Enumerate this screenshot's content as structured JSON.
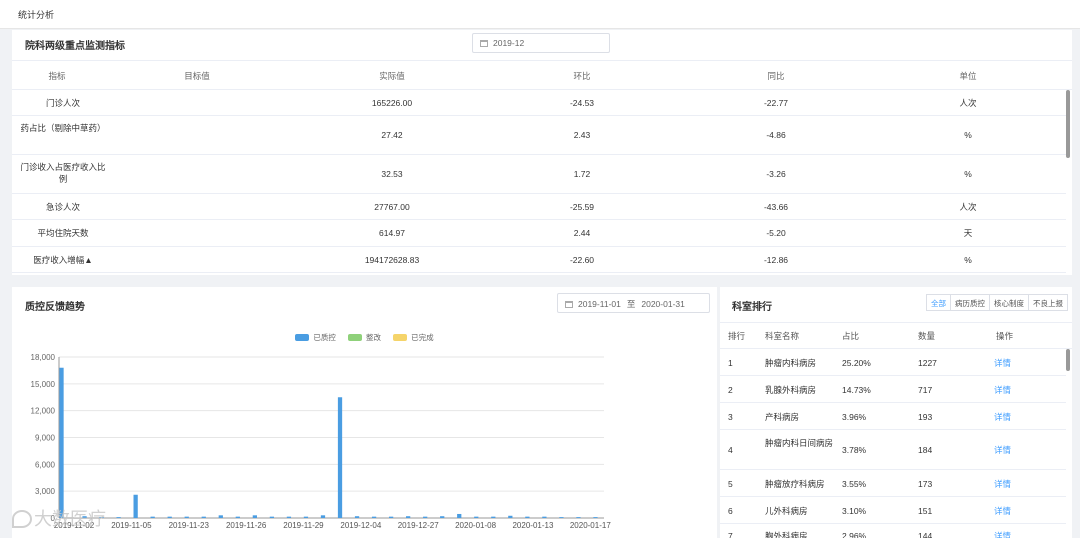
{
  "header": {
    "title": "统计分析"
  },
  "indicators": {
    "title": "院科两级重点监测指标",
    "date": "2019-12",
    "columns": [
      "指标",
      "目标值",
      "实际值",
      "环比",
      "同比",
      "单位"
    ],
    "rows": [
      {
        "name": "门诊人次",
        "target": "",
        "actual": "165226.00",
        "mom": "-24.53",
        "yoy": "-22.77",
        "unit": "人次"
      },
      {
        "name": "药占比（剔除中草药）",
        "target": "",
        "actual": "27.42",
        "mom": "2.43",
        "yoy": "-4.86",
        "unit": "%"
      },
      {
        "name": "门诊收入占医疗收入比例",
        "target": "",
        "actual": "32.53",
        "mom": "1.72",
        "yoy": "-3.26",
        "unit": "%"
      },
      {
        "name": "急诊人次",
        "target": "",
        "actual": "27767.00",
        "mom": "-25.59",
        "yoy": "-43.66",
        "unit": "人次"
      },
      {
        "name": "平均住院天数",
        "target": "",
        "actual": "614.97",
        "mom": "2.44",
        "yoy": "-5.20",
        "unit": "天"
      },
      {
        "name": "医疗收入增幅▲",
        "target": "",
        "actual": "194172628.83",
        "mom": "-22.60",
        "yoy": "-12.86",
        "unit": "%"
      }
    ]
  },
  "trend": {
    "title": "质控反馈趋势",
    "date_start": "2019-11-01",
    "date_sep": "至",
    "date_end": "2020-01-31",
    "watermark": "大数医疗"
  },
  "chart_data": {
    "type": "bar",
    "x_tick_labels": [
      "2019-11-02",
      "2019-11-05",
      "2019-11-23",
      "2019-11-26",
      "2019-11-29",
      "2019-12-04",
      "2019-12-27",
      "2020-01-08",
      "2020-01-13",
      "2020-01-17"
    ],
    "y_ticks": [
      0,
      3000,
      6000,
      9000,
      12000,
      15000,
      18000
    ],
    "ylim": [
      0,
      18000
    ],
    "legend": [
      "已质控",
      "整改",
      "已完成"
    ],
    "colors": [
      "#4a9de2",
      "#8fd17a",
      "#f5d46a"
    ],
    "series": [
      {
        "name": "已质控",
        "values": [
          16800,
          200,
          100,
          100,
          2600,
          150,
          150,
          150,
          150,
          300,
          150,
          300,
          150,
          150,
          150,
          300,
          13500,
          200,
          150,
          150,
          200,
          150,
          200,
          450,
          150,
          150,
          250,
          150,
          150,
          100,
          100,
          100
        ]
      },
      {
        "name": "整改",
        "values": []
      },
      {
        "name": "已完成",
        "values": []
      }
    ]
  },
  "ranking": {
    "title": "科室排行",
    "filters": [
      "全部",
      "病历质控",
      "核心制度",
      "不良上报"
    ],
    "columns": [
      "排行",
      "科室名称",
      "占比",
      "数量",
      "操作"
    ],
    "rows": [
      {
        "rank": "1",
        "name": "肿瘤内科病房",
        "ratio": "25.20%",
        "count": "1227",
        "action": "详情"
      },
      {
        "rank": "2",
        "name": "乳腺外科病房",
        "ratio": "14.73%",
        "count": "717",
        "action": "详情"
      },
      {
        "rank": "3",
        "name": "产科病房",
        "ratio": "3.96%",
        "count": "193",
        "action": "详情"
      },
      {
        "rank": "4",
        "name": "肿瘤内科日间病房",
        "ratio": "3.78%",
        "count": "184",
        "action": "详情"
      },
      {
        "rank": "5",
        "name": "肿瘤放疗科病房",
        "ratio": "3.55%",
        "count": "173",
        "action": "详情"
      },
      {
        "rank": "6",
        "name": "儿外科病房",
        "ratio": "3.10%",
        "count": "151",
        "action": "详情"
      },
      {
        "rank": "7",
        "name": "胸外科病房",
        "ratio": "2.96%",
        "count": "144",
        "action": "详情"
      }
    ]
  }
}
